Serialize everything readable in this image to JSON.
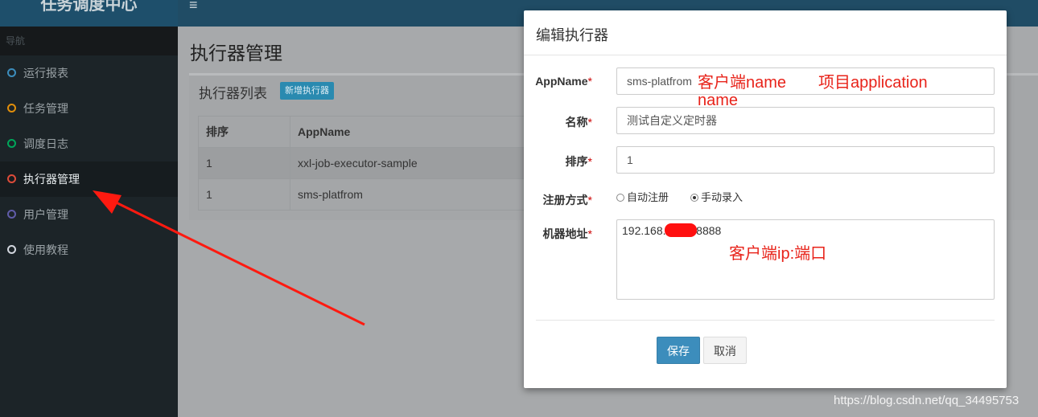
{
  "app": {
    "title": "任务调度中心",
    "menu_icon": "≡"
  },
  "sidebar": {
    "header": "导航",
    "items": [
      {
        "label": "运行报表",
        "color": "#3c8dbc"
      },
      {
        "label": "任务管理",
        "color": "#e08e0b"
      },
      {
        "label": "调度日志",
        "color": "#00a65a"
      },
      {
        "label": "执行器管理",
        "color": "#dd4b39",
        "active": true
      },
      {
        "label": "用户管理",
        "color": "#605ca8"
      },
      {
        "label": "使用教程",
        "color": "#d2d6de"
      }
    ]
  },
  "main": {
    "page_title": "执行器管理",
    "box_title": "执行器列表",
    "add_button": "新增执行器",
    "table": {
      "headers": [
        "排序",
        "AppName"
      ],
      "rows": [
        [
          "1",
          "xxl-job-executor-sample"
        ],
        [
          "1",
          "sms-platfrom"
        ]
      ]
    }
  },
  "modal": {
    "title": "编辑执行器",
    "fields": {
      "appname": {
        "label": "AppName",
        "value": "sms-platfrom"
      },
      "name": {
        "label": "名称",
        "value": "测试自定义定时器"
      },
      "order": {
        "label": "排序",
        "value": "1"
      },
      "register": {
        "label": "注册方式",
        "options": [
          "自动注册",
          "手动录入"
        ],
        "selected": "手动录入"
      },
      "address": {
        "label": "机器地址",
        "value_prefix": "192.168.1",
        "value_suffix": ":8888"
      }
    },
    "required_mark": "*",
    "save": "保存",
    "cancel": "取消"
  },
  "annotations": {
    "appname_note_1": "客户端name",
    "appname_note_2": "项目application",
    "appname_note_3": "name",
    "address_note": "客户端ip:端口"
  },
  "watermark": "https://blog.csdn.net/qq_34495753",
  "colors": {
    "accent": "#3c8dbc",
    "annotation": "#e8231a",
    "sidebar": "#1c2428"
  }
}
